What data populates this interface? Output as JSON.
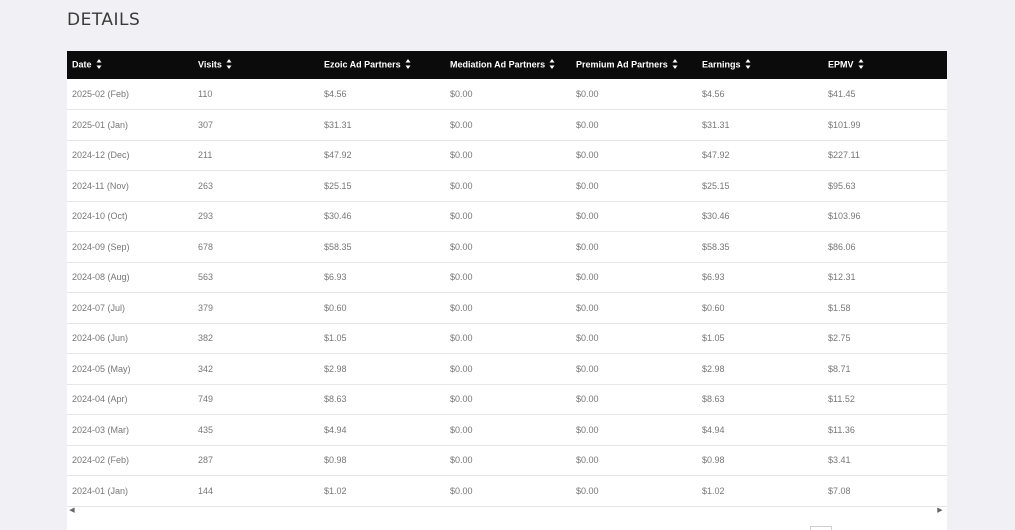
{
  "section": {
    "title": "DETAILS"
  },
  "table": {
    "columns": [
      {
        "label": "Date"
      },
      {
        "label": "Visits"
      },
      {
        "label": "Ezoic Ad Partners"
      },
      {
        "label": "Mediation Ad Partners"
      },
      {
        "label": "Premium Ad Partners"
      },
      {
        "label": "Earnings"
      },
      {
        "label": "EPMV"
      }
    ],
    "rows": [
      [
        "2025-02 (Feb)",
        "110",
        "$4.56",
        "$0.00",
        "$0.00",
        "$4.56",
        "$41.45"
      ],
      [
        "2025-01 (Jan)",
        "307",
        "$31.31",
        "$0.00",
        "$0.00",
        "$31.31",
        "$101.99"
      ],
      [
        "2024-12 (Dec)",
        "211",
        "$47.92",
        "$0.00",
        "$0.00",
        "$47.92",
        "$227.11"
      ],
      [
        "2024-11 (Nov)",
        "263",
        "$25.15",
        "$0.00",
        "$0.00",
        "$25.15",
        "$95.63"
      ],
      [
        "2024-10 (Oct)",
        "293",
        "$30.46",
        "$0.00",
        "$0.00",
        "$30.46",
        "$103.96"
      ],
      [
        "2024-09 (Sep)",
        "678",
        "$58.35",
        "$0.00",
        "$0.00",
        "$58.35",
        "$86.06"
      ],
      [
        "2024-08 (Aug)",
        "563",
        "$6.93",
        "$0.00",
        "$0.00",
        "$6.93",
        "$12.31"
      ],
      [
        "2024-07 (Jul)",
        "379",
        "$0.60",
        "$0.00",
        "$0.00",
        "$0.60",
        "$1.58"
      ],
      [
        "2024-06 (Jun)",
        "382",
        "$1.05",
        "$0.00",
        "$0.00",
        "$1.05",
        "$2.75"
      ],
      [
        "2024-05 (May)",
        "342",
        "$2.98",
        "$0.00",
        "$0.00",
        "$2.98",
        "$8.71"
      ],
      [
        "2024-04 (Apr)",
        "749",
        "$8.63",
        "$0.00",
        "$0.00",
        "$8.63",
        "$11.52"
      ],
      [
        "2024-03 (Mar)",
        "435",
        "$4.94",
        "$0.00",
        "$0.00",
        "$4.94",
        "$11.36"
      ],
      [
        "2024-02 (Feb)",
        "287",
        "$0.98",
        "$0.00",
        "$0.00",
        "$0.98",
        "$3.41"
      ],
      [
        "2024-01 (Jan)",
        "144",
        "$1.02",
        "$0.00",
        "$0.00",
        "$1.02",
        "$7.08"
      ]
    ]
  },
  "scrollbar": {
    "left_icon": "arrow-left-icon",
    "right_icon": "arrow-right-icon",
    "left_glyph": "◀",
    "right_glyph": "▶"
  },
  "colors": {
    "header_bg": "#0b0b0b",
    "page_bg": "#f1f1f5",
    "cell_text": "#777777"
  }
}
